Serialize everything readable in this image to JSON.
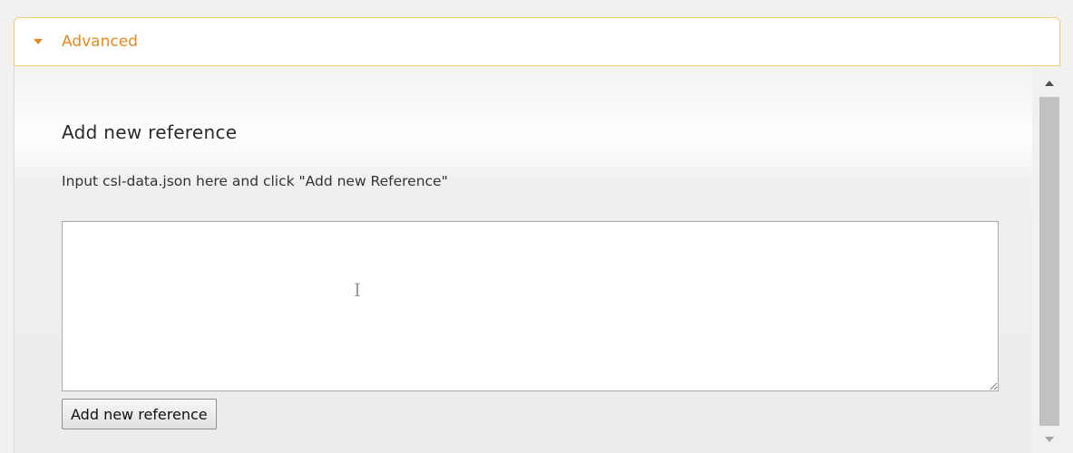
{
  "panel": {
    "header_title": "Advanced",
    "header_icon": "caret-down-icon",
    "accent_color": "#e8891c",
    "border_color": "#f0cc6a"
  },
  "reference_form": {
    "title": "Add new reference",
    "description": "Input csl-data.json here and click \"Add new Reference\"",
    "input_value": "",
    "button_label": "Add new reference"
  },
  "scrollbar": {
    "up_icon": "scroll-up-arrow-icon",
    "down_icon": "scroll-down-arrow-icon"
  },
  "pointer": {
    "icon": "text-cursor-icon",
    "glyph": "I"
  }
}
